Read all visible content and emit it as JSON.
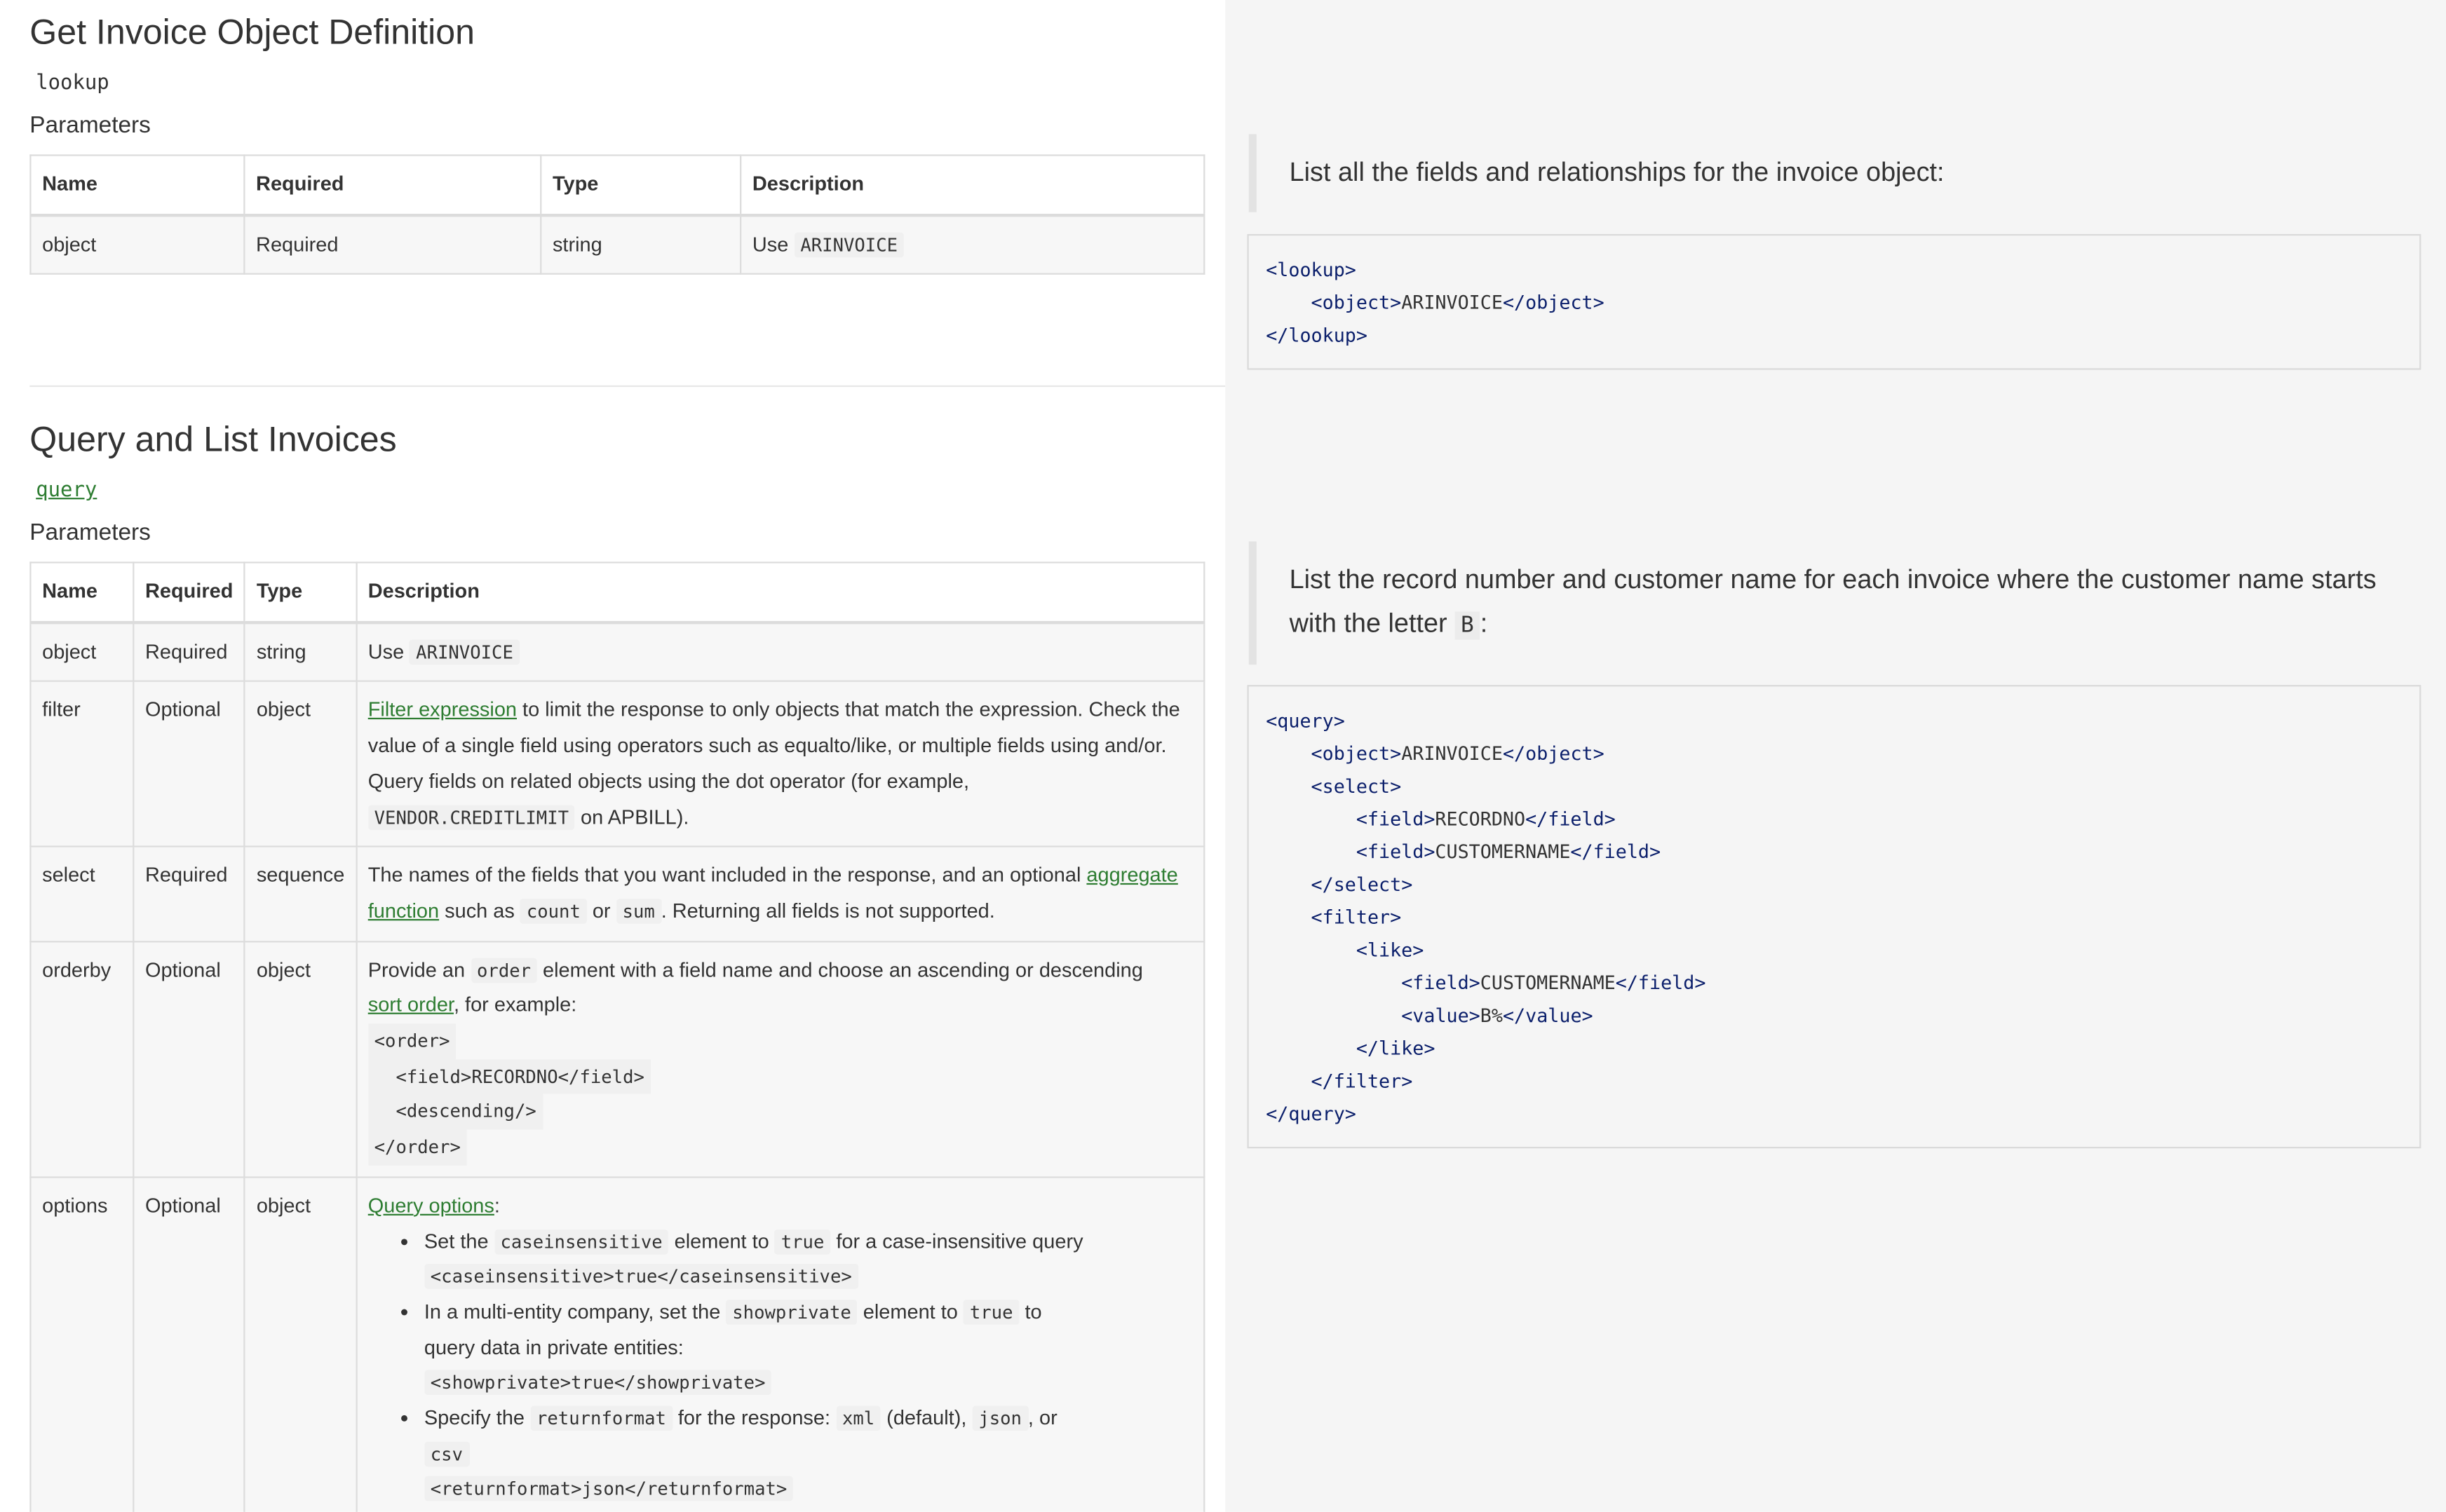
{
  "section1": {
    "title": "Get Invoice Object Definition",
    "method": "lookup",
    "params_label": "Parameters",
    "headers": [
      "Name",
      "Required",
      "Type",
      "Description"
    ],
    "row": {
      "name": "object",
      "required": "Required",
      "type": "string",
      "desc_prefix": "Use",
      "desc_code": "ARINVOICE"
    },
    "note": "List all the fields and relationships for the invoice object:",
    "code": [
      "<lookup>",
      "<object>",
      "ARINVOICE",
      "</object>",
      "</lookup>"
    ]
  },
  "section2": {
    "title": "Query and List Invoices",
    "method": "query",
    "params_label": "Parameters",
    "headers": [
      "Name",
      "Required",
      "Type",
      "Description"
    ],
    "rows": {
      "object": {
        "name": "object",
        "required": "Required",
        "type": "string",
        "desc_prefix": "Use",
        "desc_code": "ARINVOICE"
      },
      "filter": {
        "name": "filter",
        "required": "Optional",
        "type": "object",
        "link": "Filter expression",
        "text1": " to limit the response to only objects that match the expression. Check the value of a single field using operators such as equalto/like, or multiple fields using and/or. Query fields on related objects using the dot operator (for example, ",
        "code": "VENDOR.CREDITLIMIT",
        "text2": " on APBILL)."
      },
      "select": {
        "name": "select",
        "required": "Required",
        "type": "sequence",
        "text1": "The names of the fields that you want included in the response, and an optional ",
        "link": "aggregate function",
        "text2": " such as ",
        "code1": "count",
        "text3": " or ",
        "code2": "sum",
        "text4": ". Returning all fields is not supported."
      },
      "orderby": {
        "name": "orderby",
        "required": "Optional",
        "type": "object",
        "text1": "Provide an ",
        "code": "order",
        "text2": " element with a field name and choose an ascending or descending ",
        "link": "sort order",
        "text3": ", for example:",
        "code_lines": [
          "<order>",
          "  <field>RECORDNO</field>",
          "  <descending/>",
          "</order>"
        ]
      },
      "options": {
        "name": "options",
        "required": "Optional",
        "type": "object",
        "link": "Query options",
        "colon": ":",
        "b1": {
          "t1": "Set the ",
          "c1": "caseinsensitive",
          "t2": " element to ",
          "c2": "true",
          "t3": " for a case-insensitive query",
          "ex": "<caseinsensitive>true</caseinsensitive>"
        },
        "b2": {
          "t1": "In a multi-entity company, set the ",
          "c1": "showprivate",
          "t2": " element to ",
          "c2": "true",
          "t3": " to query data in private entities:",
          "ex": "<showprivate>true</showprivate>"
        },
        "b3": {
          "t1": "Specify the ",
          "c1": "returnformat",
          "t2": " for the response: ",
          "c2": "xml",
          "t3": " (default), ",
          "c3": "json",
          "t4": ", or ",
          "c4": "csv",
          "ex": "<returnformat>json</returnformat>"
        }
      }
    },
    "note_text": "List the record number and customer name for each invoice where the customer name starts with the letter ",
    "note_code": "B",
    "note_end": ":",
    "code": {
      "l1": "<query>",
      "l2_open": "<object>",
      "l2_val": "ARINVOICE",
      "l2_close": "</object>",
      "l3": "<select>",
      "l4_open": "<field>",
      "l4_val": "RECORDNO",
      "l4_close": "</field>",
      "l5_open": "<field>",
      "l5_val": "CUSTOMERNAME",
      "l5_close": "</field>",
      "l6": "</select>",
      "l7": "<filter>",
      "l8": "<like>",
      "l9_open": "<field>",
      "l9_val": "CUSTOMERNAME",
      "l9_close": "</field>",
      "l10_open": "<value>",
      "l10_val": "B%",
      "l10_close": "</value>",
      "l11": "</like>",
      "l12": "</filter>",
      "l13": "</query>"
    }
  }
}
